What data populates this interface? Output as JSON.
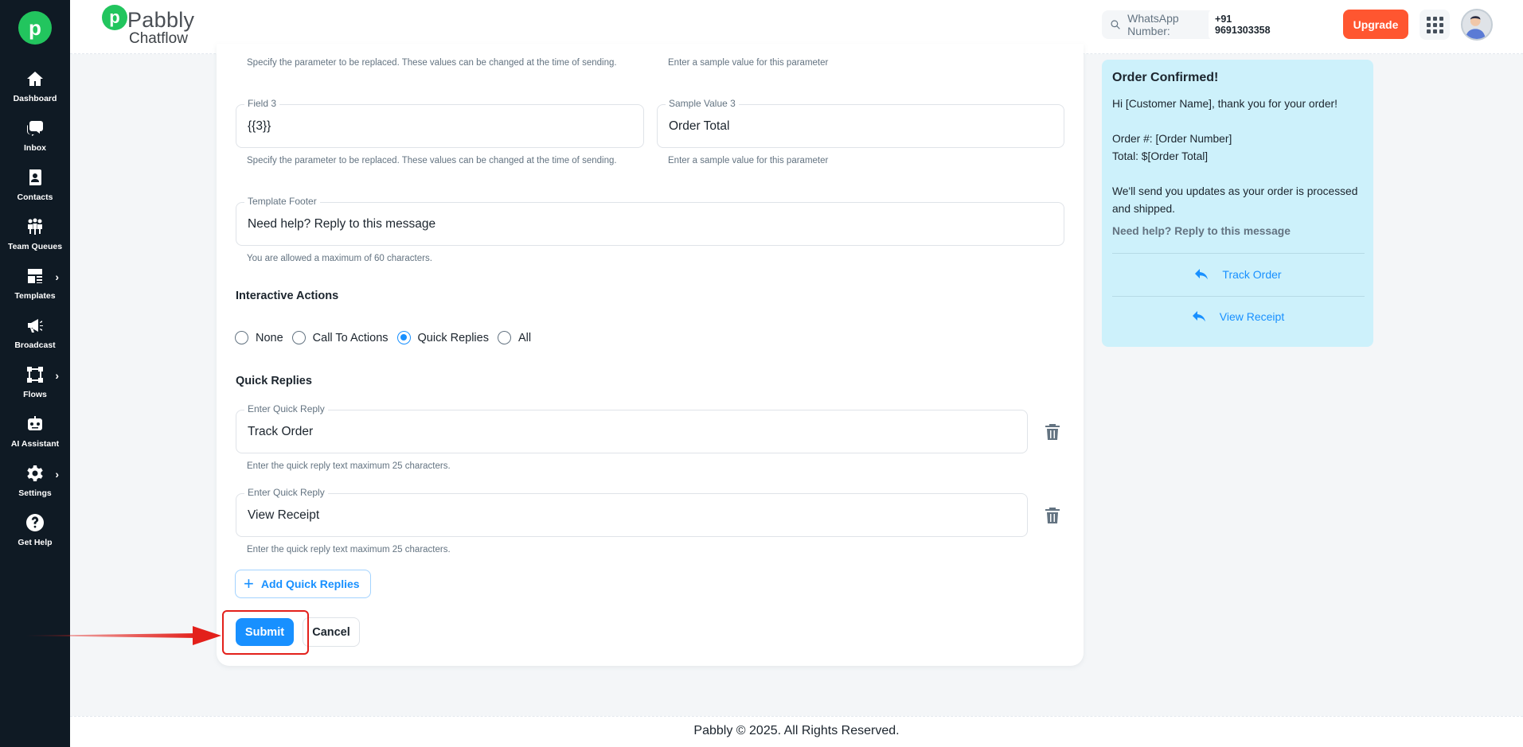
{
  "sidebar": {
    "items": [
      {
        "label": "Dashboard",
        "icon": "home-icon"
      },
      {
        "label": "Inbox",
        "icon": "chat-icon"
      },
      {
        "label": "Contacts",
        "icon": "contacts-icon"
      },
      {
        "label": "Team Queues",
        "icon": "team-icon"
      },
      {
        "label": "Templates",
        "icon": "templates-icon"
      },
      {
        "label": "Broadcast",
        "icon": "megaphone-icon"
      },
      {
        "label": "Flows",
        "icon": "flows-icon"
      },
      {
        "label": "AI Assistant",
        "icon": "robot-icon"
      },
      {
        "label": "Settings",
        "icon": "gear-icon"
      },
      {
        "label": "Get Help",
        "icon": "help-icon"
      }
    ]
  },
  "header": {
    "brand_name": "Pabbly",
    "brand_sub": "Chatflow",
    "whatsapp_label": "WhatsApp Number:",
    "whatsapp_number": "+91 9691303358",
    "upgrade_label": "Upgrade"
  },
  "form": {
    "field2_helper": "Specify the parameter to be replaced. These values can be changed at the time of sending.",
    "sample2_helper": "Enter a sample value for this parameter",
    "field3": {
      "label": "Field 3",
      "value": "{{3}}",
      "helper": "Specify the parameter to be replaced. These values can be changed at the time of sending."
    },
    "sample3": {
      "label": "Sample Value 3",
      "value": "Order Total",
      "helper": "Enter a sample value for this parameter"
    },
    "footer": {
      "label": "Template Footer",
      "value": "Need help? Reply to this message",
      "helper": "You are allowed a maximum of 60 characters."
    },
    "interactive_title": "Interactive Actions",
    "interactive_options": [
      "None",
      "Call To Actions",
      "Quick Replies",
      "All"
    ],
    "interactive_selected": "Quick Replies",
    "quick_replies_title": "Quick Replies",
    "quick_replies": [
      {
        "label": "Enter Quick Reply",
        "value": "Track Order",
        "helper": "Enter the quick reply text maximum 25 characters."
      },
      {
        "label": "Enter Quick Reply",
        "value": "View Receipt",
        "helper": "Enter the quick reply text maximum 25 characters."
      }
    ],
    "add_quick_replies_label": "Add Quick Replies",
    "submit_label": "Submit",
    "cancel_label": "Cancel"
  },
  "preview": {
    "title": "Order Confirmed!",
    "body": "Hi [Customer Name], thank you for your order!\n\nOrder #: [Order Number]\nTotal: $[Order Total]\n\nWe'll send you updates as your order is processed and shipped.",
    "footer": "Need help? Reply to this message",
    "buttons": [
      "Track Order",
      "View Receipt"
    ]
  },
  "page_footer": "Pabbly © 2025. All Rights Reserved.",
  "colors": {
    "primary": "#1890ff",
    "upgrade": "#ff5630",
    "sidebar": "#0f1a24",
    "preview_bg": "#cdf1fb",
    "annotation": "#e3201b"
  }
}
